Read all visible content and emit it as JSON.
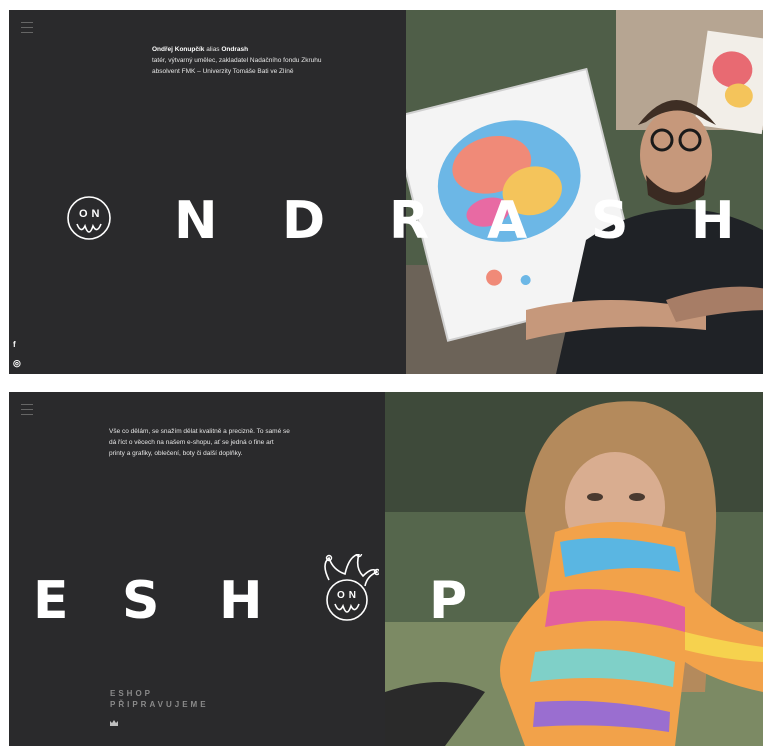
{
  "hero": {
    "intro_name": "Ondřej Konupčík",
    "intro_alias_word": "alias",
    "intro_alias": "Ondrash",
    "intro_line1": "tatér, výtvarný umělec, zakladatel Nadačního fondu Zkruhu",
    "intro_line2": "absolvent FMK – Univerzity Tomáše Bati ve Zlíně",
    "logo_text": "ON",
    "letters": [
      "N",
      "D",
      "R",
      "A",
      "S",
      "H"
    ],
    "social": {
      "facebook": "f",
      "instagram": "◎"
    }
  },
  "eshop": {
    "intro_line1": "Vše co dělám, se snažím dělat kvalitně a precizně. To samé se",
    "intro_line2": "dá říct o věcech na našem e-shopu, ať se jedná o fine art",
    "intro_line3": "printy a grafiky, oblečení, boty či další doplňky.",
    "letters": [
      "E",
      "S",
      "H",
      "P"
    ],
    "logo_text": "ON",
    "label_line1": "ESHOP",
    "label_line2": "PŘIPRAVUJEME"
  },
  "colors": {
    "panel_bg": "#2a2a2c",
    "text": "#ffffff",
    "muted_label": "#8a8a8a"
  },
  "icons": [
    "menu-icon",
    "on-logo",
    "jester-logo",
    "facebook-icon",
    "instagram-icon",
    "crown-icon"
  ]
}
